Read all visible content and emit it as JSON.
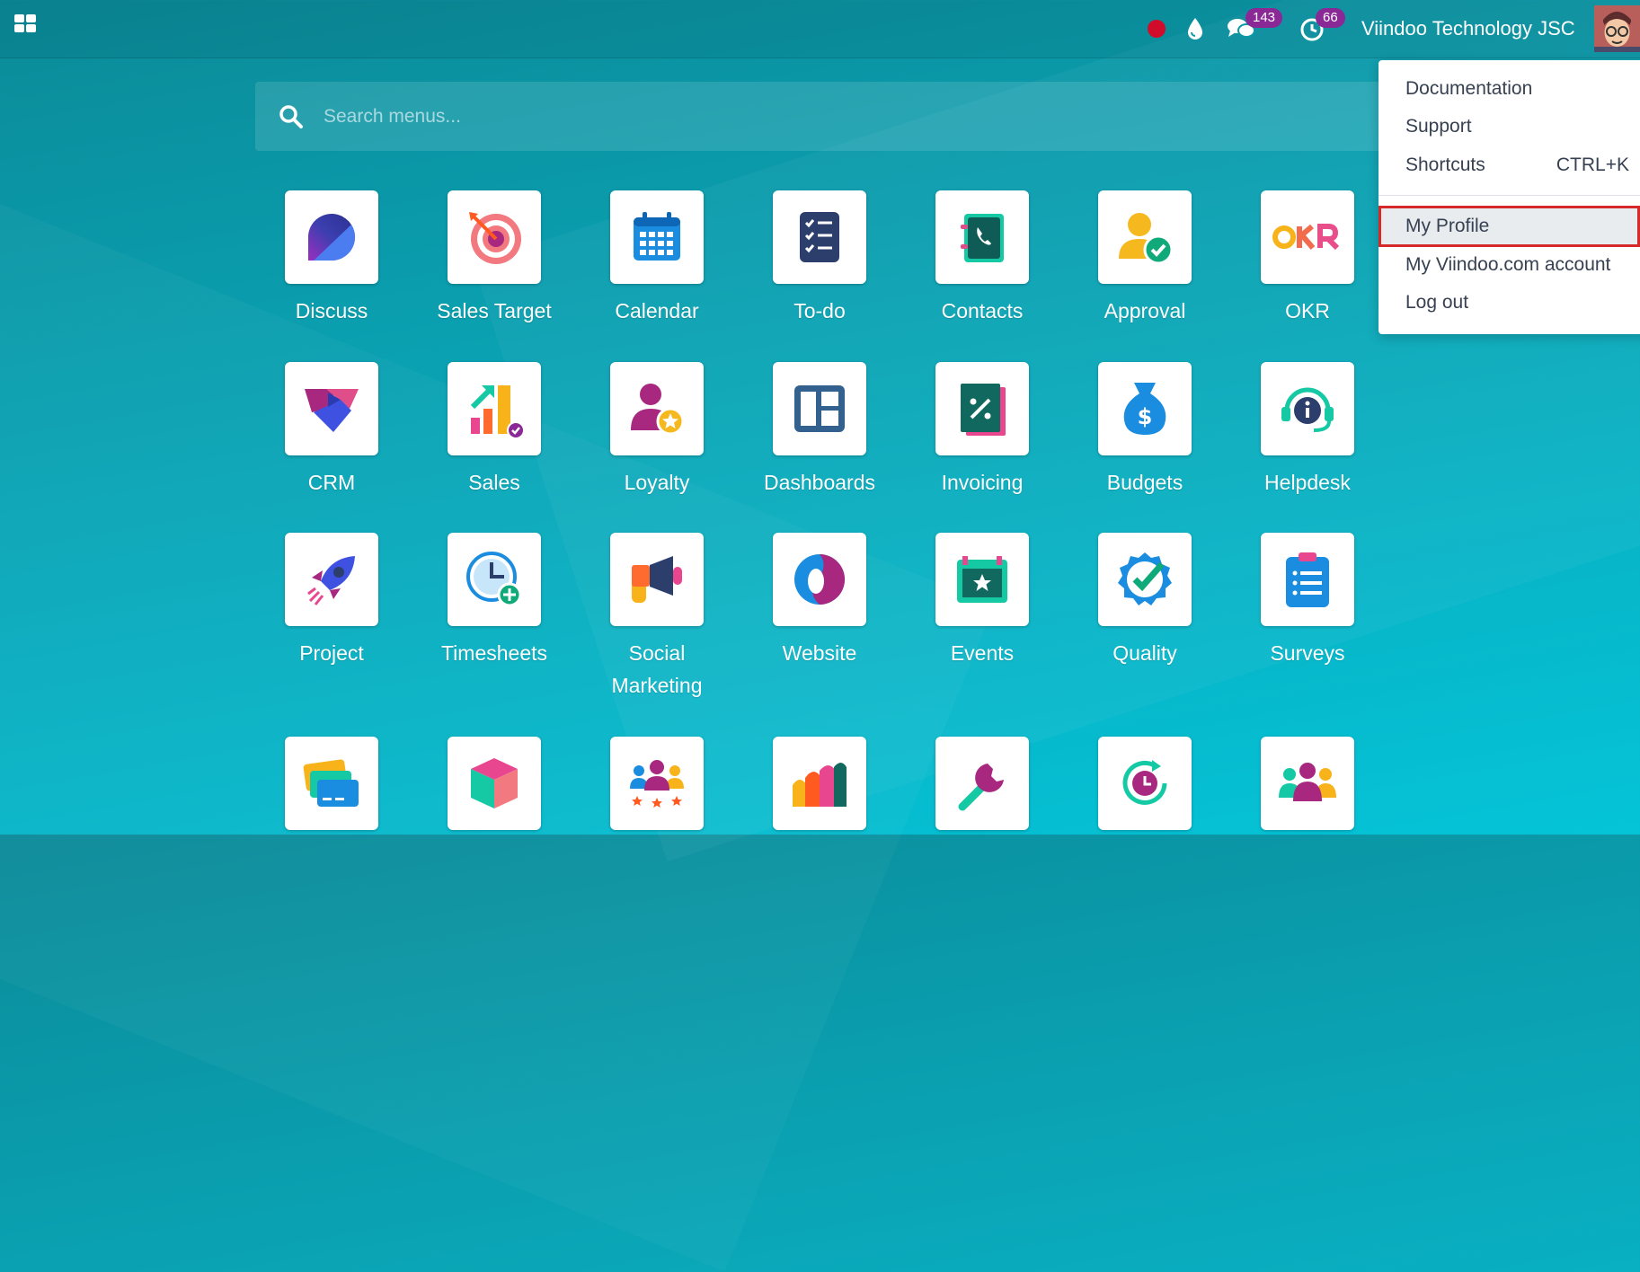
{
  "topbar": {
    "company_name": "Viindoo Technology JSC",
    "messages_count": "143",
    "activities_count": "66"
  },
  "search": {
    "placeholder": "Search menus..."
  },
  "user_menu": {
    "items": [
      {
        "label": "Documentation",
        "shortcut": ""
      },
      {
        "label": "Support",
        "shortcut": ""
      },
      {
        "label": "Shortcuts",
        "shortcut": "CTRL+K"
      },
      {
        "label": "My Profile",
        "shortcut": ""
      },
      {
        "label": "My Viindoo.com account",
        "shortcut": ""
      },
      {
        "label": "Log out",
        "shortcut": ""
      }
    ]
  },
  "apps": [
    {
      "label": "Discuss",
      "icon": "discuss-icon"
    },
    {
      "label": "Sales Target",
      "icon": "target-icon"
    },
    {
      "label": "Calendar",
      "icon": "calendar-icon"
    },
    {
      "label": "To-do",
      "icon": "todo-icon"
    },
    {
      "label": "Contacts",
      "icon": "contacts-icon"
    },
    {
      "label": "Approval",
      "icon": "approval-icon"
    },
    {
      "label": "OKR",
      "icon": "okr-icon"
    },
    {
      "label": "CRM",
      "icon": "crm-icon"
    },
    {
      "label": "Sales",
      "icon": "sales-icon"
    },
    {
      "label": "Loyalty",
      "icon": "loyalty-icon"
    },
    {
      "label": "Dashboards",
      "icon": "dashboards-icon"
    },
    {
      "label": "Invoicing",
      "icon": "invoicing-icon"
    },
    {
      "label": "Budgets",
      "icon": "budgets-icon"
    },
    {
      "label": "Helpdesk",
      "icon": "helpdesk-icon"
    },
    {
      "label": "Project",
      "icon": "rocket-icon"
    },
    {
      "label": "Timesheets",
      "icon": "timesheets-icon"
    },
    {
      "label": "Social Marketing",
      "icon": "megaphone-icon"
    },
    {
      "label": "Website",
      "icon": "website-icon"
    },
    {
      "label": "Events",
      "icon": "events-icon"
    },
    {
      "label": "Quality",
      "icon": "quality-icon"
    },
    {
      "label": "Surveys",
      "icon": "surveys-icon"
    },
    {
      "label": "",
      "icon": "payment-cards-icon"
    },
    {
      "label": "",
      "icon": "cube-icon"
    },
    {
      "label": "",
      "icon": "team-rating-icon"
    },
    {
      "label": "",
      "icon": "bar-chart-icon"
    },
    {
      "label": "",
      "icon": "wrench-icon"
    },
    {
      "label": "",
      "icon": "clock-cycle-icon"
    },
    {
      "label": "",
      "icon": "employees-icon"
    }
  ]
}
